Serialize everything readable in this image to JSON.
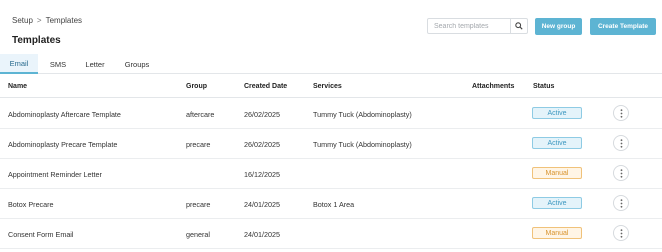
{
  "breadcrumb": {
    "root": "Setup",
    "separator": ">",
    "current": "Templates"
  },
  "page": {
    "title": "Templates"
  },
  "search": {
    "placeholder": "Search templates"
  },
  "actions": {
    "new_group": "New group",
    "create_template": "Create Template"
  },
  "tabs": [
    {
      "label": "Email",
      "active": true
    },
    {
      "label": "SMS",
      "active": false
    },
    {
      "label": "Letter",
      "active": false
    },
    {
      "label": "Groups",
      "active": false
    }
  ],
  "table": {
    "columns": [
      "Name",
      "Group",
      "Created Date",
      "Services",
      "Attachments",
      "Status"
    ],
    "rows": [
      {
        "name": "Abdominoplasty Aftercare Template",
        "group": "aftercare",
        "created": "26/02/2025",
        "services": "Tummy Tuck (Abdominoplasty)",
        "attachments": "",
        "status": "Active"
      },
      {
        "name": "Abdominoplasty Precare Template",
        "group": "precare",
        "created": "26/02/2025",
        "services": "Tummy Tuck (Abdominoplasty)",
        "attachments": "",
        "status": "Active"
      },
      {
        "name": "Appointment Reminder Letter",
        "group": "",
        "created": "16/12/2025",
        "services": "",
        "attachments": "",
        "status": "Manual"
      },
      {
        "name": "Botox Precare",
        "group": "precare",
        "created": "24/01/2025",
        "services": "Botox 1 Area",
        "attachments": "",
        "status": "Active"
      },
      {
        "name": "Consent Form Email",
        "group": "general",
        "created": "24/01/2025",
        "services": "",
        "attachments": "",
        "status": "Manual"
      }
    ]
  },
  "colors": {
    "accent": "#5db4d3",
    "active_badge": "#3c97c0",
    "manual_badge": "#d9942e"
  },
  "icons": {
    "search": "search-icon",
    "row_menu": "kebab-menu-icon"
  }
}
